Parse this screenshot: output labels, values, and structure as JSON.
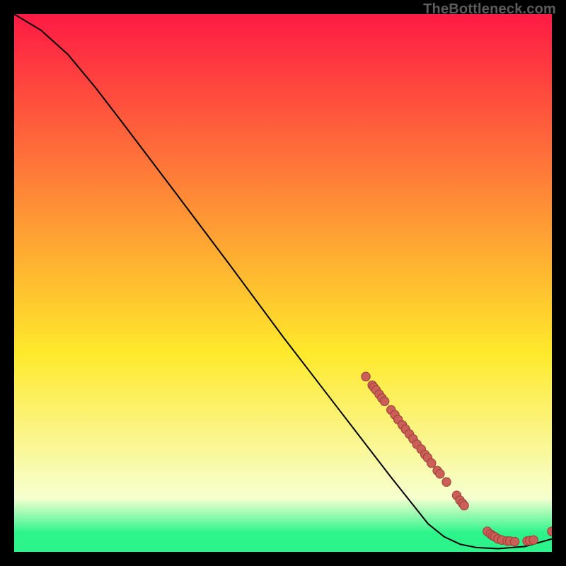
{
  "attribution": "TheBottleneck.com",
  "colors": {
    "bg": "#000000",
    "curve": "#000000",
    "point": "#cb5f57",
    "point_stroke": "#9a3e38",
    "grad_top": "#ff1a44",
    "grad_yellow": "#ffe92b",
    "grad_pale": "#f7ffd0",
    "grad_green": "#2cf48b"
  },
  "chart_data": {
    "type": "line",
    "title": "",
    "xlabel": "",
    "ylabel": "",
    "xlim": [
      0,
      100
    ],
    "ylim": [
      0,
      100
    ],
    "curve": [
      {
        "x": 0.0,
        "y": 100.0
      },
      {
        "x": 5.0,
        "y": 97.0
      },
      {
        "x": 10.0,
        "y": 92.5
      },
      {
        "x": 15.0,
        "y": 86.5
      },
      {
        "x": 20.0,
        "y": 80.0
      },
      {
        "x": 30.0,
        "y": 66.8
      },
      {
        "x": 40.0,
        "y": 53.5
      },
      {
        "x": 50.0,
        "y": 40.0
      },
      {
        "x": 60.0,
        "y": 27.0
      },
      {
        "x": 70.0,
        "y": 14.0
      },
      {
        "x": 77.0,
        "y": 5.2
      },
      {
        "x": 80.0,
        "y": 2.8
      },
      {
        "x": 83.0,
        "y": 1.4
      },
      {
        "x": 86.0,
        "y": 0.8
      },
      {
        "x": 90.0,
        "y": 0.6
      },
      {
        "x": 95.0,
        "y": 1.0
      },
      {
        "x": 100.0,
        "y": 2.4
      }
    ],
    "series": [
      {
        "name": "points",
        "data": [
          {
            "x": 65.4,
            "y": 32.6
          },
          {
            "x": 66.6,
            "y": 31.0
          },
          {
            "x": 66.9,
            "y": 30.6
          },
          {
            "x": 67.3,
            "y": 30.1
          },
          {
            "x": 67.9,
            "y": 29.3
          },
          {
            "x": 68.4,
            "y": 28.6
          },
          {
            "x": 68.9,
            "y": 28.0
          },
          {
            "x": 70.1,
            "y": 26.4
          },
          {
            "x": 70.8,
            "y": 25.5
          },
          {
            "x": 71.4,
            "y": 24.6
          },
          {
            "x": 72.2,
            "y": 23.6
          },
          {
            "x": 72.8,
            "y": 22.8
          },
          {
            "x": 73.5,
            "y": 21.9
          },
          {
            "x": 74.2,
            "y": 21.0
          },
          {
            "x": 74.9,
            "y": 20.0
          },
          {
            "x": 75.7,
            "y": 19.1
          },
          {
            "x": 76.4,
            "y": 18.1
          },
          {
            "x": 76.9,
            "y": 17.5
          },
          {
            "x": 77.6,
            "y": 16.5
          },
          {
            "x": 78.7,
            "y": 15.1
          },
          {
            "x": 79.2,
            "y": 14.5
          },
          {
            "x": 80.4,
            "y": 13.0
          },
          {
            "x": 82.3,
            "y": 10.5
          },
          {
            "x": 82.9,
            "y": 9.6
          },
          {
            "x": 83.4,
            "y": 9.0
          },
          {
            "x": 83.7,
            "y": 8.6
          },
          {
            "x": 88.0,
            "y": 3.8
          },
          {
            "x": 88.6,
            "y": 3.3
          },
          {
            "x": 89.0,
            "y": 3.0
          },
          {
            "x": 89.4,
            "y": 2.8
          },
          {
            "x": 90.0,
            "y": 2.4
          },
          {
            "x": 90.7,
            "y": 2.2
          },
          {
            "x": 91.7,
            "y": 2.0
          },
          {
            "x": 92.2,
            "y": 2.0
          },
          {
            "x": 93.1,
            "y": 1.9
          },
          {
            "x": 95.4,
            "y": 2.0
          },
          {
            "x": 95.9,
            "y": 2.1
          },
          {
            "x": 96.6,
            "y": 2.2
          },
          {
            "x": 100.0,
            "y": 3.8
          }
        ]
      }
    ],
    "gradient_stops": [
      {
        "offset": 0.0,
        "key": "grad_top"
      },
      {
        "offset": 0.63,
        "key": "grad_yellow"
      },
      {
        "offset": 0.9,
        "key": "grad_pale"
      },
      {
        "offset": 0.965,
        "key": "grad_green"
      },
      {
        "offset": 1.0,
        "key": "grad_green"
      }
    ]
  }
}
